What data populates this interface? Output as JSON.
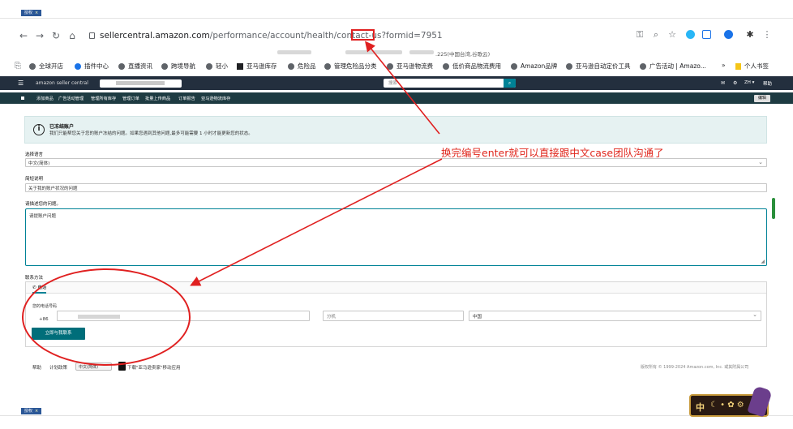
{
  "browser": {
    "tab_label": "授权",
    "tab_close": "×",
    "url_host": "sellercentral.amazon.com",
    "url_path": "/performance/account/health/contact-us?formid=",
    "url_formid": "7951",
    "ip_note": ".225(中国台湾,谷歌云)",
    "bookmarks": [
      "全球开店",
      "插件中心",
      "直播资讯",
      "跨境导航",
      "轻小",
      "亚马逊库存",
      "危险品",
      "管理危险品分类",
      "亚马逊物流费",
      "低价商品物流费用",
      "Amazon品牌",
      "亚马逊自动定价工具",
      "广告活动 | Amazo..."
    ],
    "bookmark_more": "»",
    "personal_bookmarks": "个人书签"
  },
  "seller_central": {
    "logo": "amazon seller central",
    "search_placeholder": "搜索",
    "lang": "ZH",
    "help": "帮助",
    "nav": [
      "添加商品",
      "广告活动管理",
      "管理所有库存",
      "管理订单",
      "批量上传商品",
      "订单报告",
      "亚马逊物流库存"
    ],
    "edit": "编辑"
  },
  "alert": {
    "title": "已冻结账户",
    "body": "我们只能帮您关于您的账户冻结的问题。如果您遇到其他问题,最多可能需要 1 小时才能更新您的状态。"
  },
  "form": {
    "language_label": "选择语言",
    "language_value": "中文(简体)",
    "subject_label": "简短说明",
    "subject_value": "关于我的账户状况的问题",
    "description_label": "请描述您的问题。",
    "description_value": "请提账户问题",
    "contact_method_label": "联系方法",
    "phone_tab": "电话",
    "phone_label": "您的电话号码",
    "country_code": "+86",
    "extension_placeholder": "分机",
    "country_value": "中国",
    "call_button": "立即与我联系"
  },
  "footer": {
    "help": "帮助",
    "policy": "计划政策",
    "language": "中文(简体)",
    "app_link": "下载\"亚马逊卖家\"移动应用",
    "copyright": "版权所有 © 1999-2024 Amazon.com, Inc. 或其附属公司"
  },
  "annotation": {
    "note": "换完编号enter就可以直接跟中文case团队沟通了",
    "color": "#e0281e"
  },
  "widget": {
    "label": "中"
  },
  "bottom_tab_label": "授权"
}
